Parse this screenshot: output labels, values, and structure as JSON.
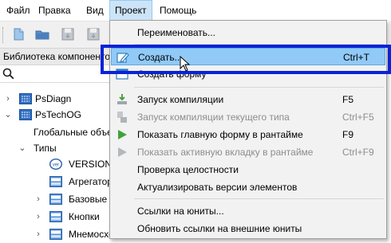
{
  "menubar": {
    "items": [
      "Файл",
      "Правка",
      "Вид",
      "Проект",
      "Помощь"
    ],
    "active_index": 3
  },
  "library": {
    "header": "Библиотека компонентов",
    "search_placeholder": ""
  },
  "tree": [
    {
      "label": "PsDiagn",
      "toggle": "›",
      "icon": "library-icon"
    },
    {
      "label": "PsTechOG",
      "toggle": "⌄",
      "icon": "library-icon"
    },
    {
      "label": "Глобальные объекты",
      "toggle": "",
      "icon": ""
    },
    {
      "label": "Типы",
      "toggle": "⌄",
      "icon": ""
    },
    {
      "label": "VERSION",
      "toggle": "",
      "icon": "type-icon"
    },
    {
      "label": "Агрегаторы",
      "toggle": "",
      "icon": "type-icon"
    },
    {
      "label": "Базовые элементы",
      "toggle": "›",
      "icon": "type-icon"
    },
    {
      "label": "Кнопки",
      "toggle": "›",
      "icon": "type-icon"
    },
    {
      "label": "Мнемосхемы",
      "toggle": "›",
      "icon": "type-icon"
    }
  ],
  "project_menu": {
    "rename": {
      "label": "Переименовать...",
      "shortcut": ""
    },
    "create": {
      "label": "Создать...",
      "shortcut": "Ctrl+T"
    },
    "create_form": {
      "label": "Создать форму",
      "shortcut": ""
    },
    "compile": {
      "label": "Запуск компиляции",
      "shortcut": "F5"
    },
    "compile_type": {
      "label": "Запуск компиляции текущего типа",
      "shortcut": "Ctrl+F5"
    },
    "show_main_form": {
      "label": "Показать главную форму в рантайме",
      "shortcut": "F9"
    },
    "show_active_tab": {
      "label": "Показать активную вкладку в рантайме",
      "shortcut": "Ctrl+F9"
    },
    "check_integrity": {
      "label": "Проверка целостности",
      "shortcut": ""
    },
    "update_versions": {
      "label": "Актуализировать версии элементов",
      "shortcut": ""
    },
    "unit_links": {
      "label": "Ссылки на юниты...",
      "shortcut": ""
    },
    "update_external_links": {
      "label": "Обновить ссылки на внешние юниты",
      "shortcut": ""
    }
  },
  "colors": {
    "highlight": "#91c9f7",
    "annotation": "#0a22d8",
    "disabled_text": "#8d8d8d"
  }
}
